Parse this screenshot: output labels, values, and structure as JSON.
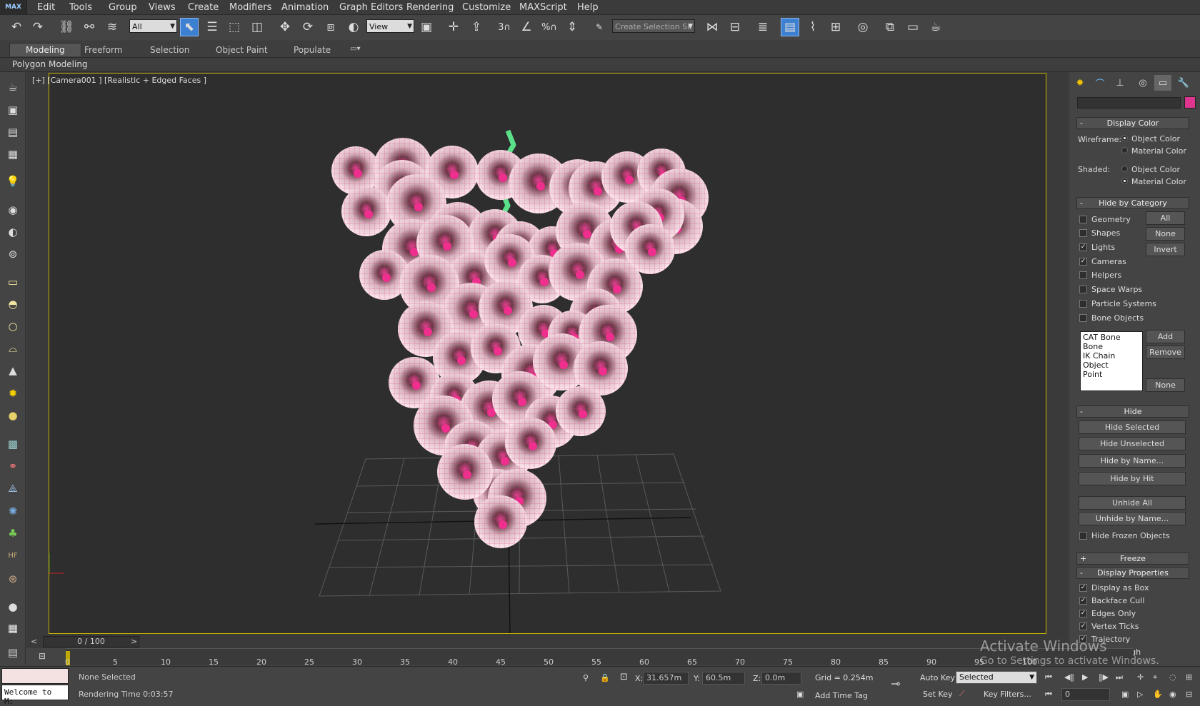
{
  "app": {
    "logo": "MAX"
  },
  "menu": [
    "Edit",
    "Tools",
    "Group",
    "Views",
    "Create",
    "Modifiers",
    "Animation",
    "Graph Editors",
    "Rendering",
    "Customize",
    "MAXScript",
    "Help"
  ],
  "toolbar": {
    "filter": "All",
    "reference_coord": "View",
    "selection_set_placeholder": "Create Selection Se"
  },
  "ribbon": {
    "tabs": [
      "Modeling",
      "Freeform",
      "Selection",
      "Object Paint",
      "Populate"
    ],
    "sub": "Polygon Modeling"
  },
  "viewport": {
    "label": "[+] [Camera001 ] [Realistic + Edged Faces ]"
  },
  "panel": {
    "display_color": {
      "title": "Display Color",
      "wireframe": "Wireframe:",
      "shaded": "Shaded:",
      "object_color": "Object Color",
      "material_color": "Material Color"
    },
    "hide_by_category": {
      "title": "Hide by Category",
      "items": [
        "Geometry",
        "Shapes",
        "Lights",
        "Cameras",
        "Helpers",
        "Space Warps",
        "Particle Systems",
        "Bone Objects"
      ],
      "checked": [
        false,
        false,
        true,
        true,
        false,
        false,
        false,
        false
      ],
      "all": "All",
      "none": "None",
      "invert": "Invert",
      "list": [
        "CAT Bone",
        "Bone",
        "IK Chain Object",
        "Point"
      ],
      "add": "Add",
      "remove": "Remove",
      "none2": "None"
    },
    "hide": {
      "title": "Hide",
      "buttons": [
        "Hide Selected",
        "Hide Unselected",
        "Hide by Name...",
        "Hide by Hit",
        "Unhide All",
        "Unhide by Name..."
      ],
      "hide_frozen": "Hide Frozen Objects"
    },
    "freeze": {
      "title": "Freeze"
    },
    "display_properties": {
      "title": "Display Properties",
      "items": [
        "Display as Box",
        "Backface Cull",
        "Edges Only",
        "Vertex Ticks",
        "Trajectory",
        "See-Through"
      ]
    }
  },
  "timeline": {
    "slider": "0 / 100",
    "ticks": [
      "0",
      "5",
      "10",
      "15",
      "20",
      "25",
      "30",
      "35",
      "40",
      "45",
      "50",
      "55",
      "60",
      "65",
      "70",
      "75",
      "80",
      "85",
      "90",
      "95",
      "100"
    ]
  },
  "status": {
    "script": "Welcome to M:",
    "selection": "None Selected",
    "rendering_time": "Rendering Time  0:03:57",
    "x_label": "X:",
    "x": "31.657m",
    "y_label": "Y:",
    "y": "60.5m",
    "z_label": "Z:",
    "z": "0.0m",
    "grid": "Grid = 0.254m",
    "add_time_tag": "Add Time Tag",
    "auto_key": "Auto Key",
    "set_key": "Set Key",
    "selected": "Selected",
    "key_filters": "Key Filters...",
    "frame": "0"
  },
  "watermark": {
    "title": "Activate Windows",
    "sub": "Go to Settings to activate Windows."
  },
  "colors": {
    "accent": "#3d7fd0",
    "viewport_border": "#c8b400",
    "grape": "#f4c6d6",
    "stem": "#5be08a"
  }
}
